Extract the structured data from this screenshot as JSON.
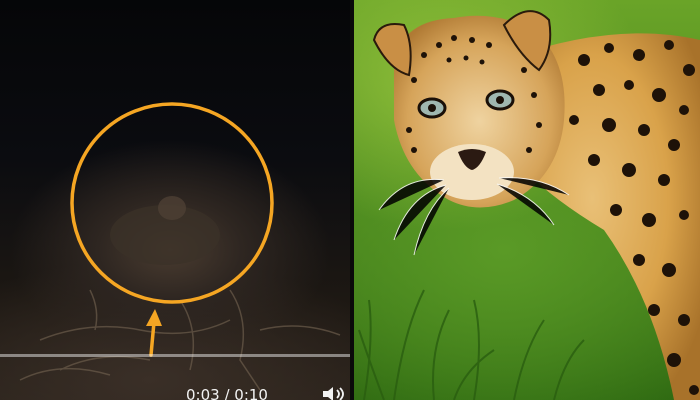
{
  "video": {
    "time_text": "0:03 / 0:10",
    "progress": 0.0
  },
  "icons": {
    "annotation": "highlight-circle",
    "pointer": "arrow-up",
    "audio": "volume-icon"
  },
  "colors": {
    "annotation": "#f5a623",
    "grass": "#4e8a1f",
    "fur": "#d9a24a"
  }
}
